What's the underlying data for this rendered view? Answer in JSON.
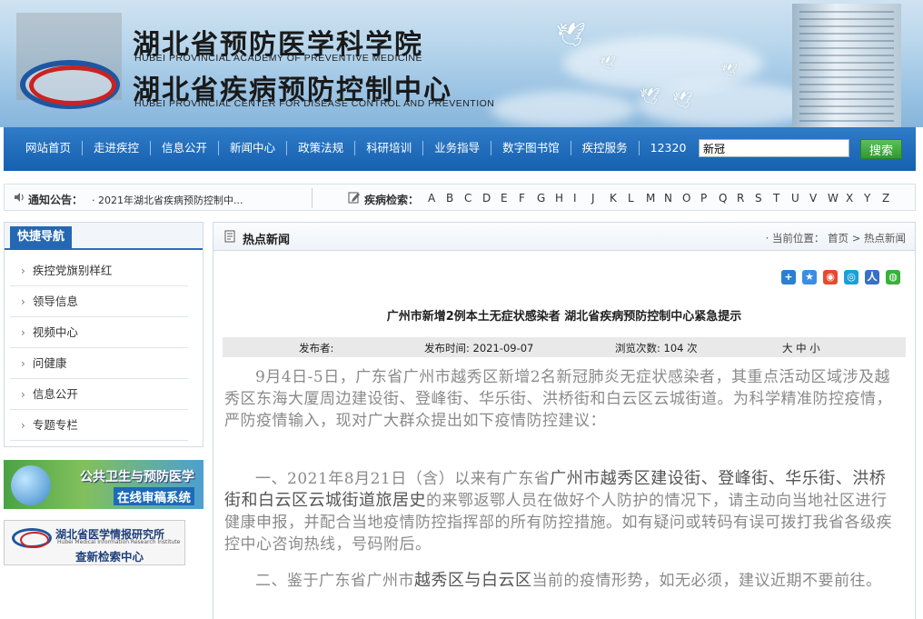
{
  "header": {
    "title_cn_1": "湖北省预防医学科学院",
    "title_en_1": "HUBEI PROVINCIAL ACADEMY OF PREVENTIVE MEDICINE",
    "title_cn_2": "湖北省疾病预防控制中心",
    "title_en_2": "HUBEI PROVINCIAL CENTER FOR DISEASE CONTROL AND PREVENTION"
  },
  "nav": {
    "items": [
      "网站首页",
      "走进疾控",
      "信息公开",
      "新闻中心",
      "政策法规",
      "科研培训",
      "业务指导",
      "数字图书馆",
      "疾控服务",
      "12320"
    ],
    "search_value": "新冠",
    "search_button": "搜索"
  },
  "notice": {
    "label": "通知公告：",
    "text": "· 2021年湖北省疾病预防控制中..."
  },
  "disease_index": {
    "label": "疾病检索：",
    "letters": [
      "A",
      "B",
      "C",
      "D",
      "E",
      "F",
      "G",
      "H",
      "I",
      "J",
      "K",
      "L",
      "M",
      "N",
      "O",
      "P",
      "Q",
      "R",
      "S",
      "T",
      "U",
      "V",
      "W",
      "X",
      "Y",
      "Z"
    ]
  },
  "sidebar": {
    "title": "快捷导航",
    "items": [
      "疾控党旗别样红",
      "领导信息",
      "视频中心",
      "问健康",
      "信息公开",
      "专题专栏"
    ]
  },
  "banners": {
    "b1_line1": "公共卫生与预防医学",
    "b1_line2": "在线审稿系统",
    "b2_line1": "湖北省医学情报研究所",
    "b2_line2": "Hubei Medical Information Research Institute",
    "b2_line3": "查新检索中心"
  },
  "main": {
    "section_title": "热点新闻",
    "breadcrumb": "· 当前位置： 首页 > 热点新闻",
    "article_title": "广州市新增2例本土无症状感染者 湖北省疾病预防控制中心紧急提示",
    "meta": {
      "publisher": "发布者:",
      "date": "发布时间: 2021-09-07",
      "views": "浏览次数: 104 次",
      "size": "大 中 小"
    },
    "paragraphs": {
      "p1": "9月4日-5日，广东省广州市越秀区新增2名新冠肺炎无症状感染者，其重点活动区域涉及越秀区东海大厦周边建设街、登峰街、华乐街、洪桥街和白云区云城街道。为科学精准防控疫情，严防疫情输入，现对广大群众提出如下疫情防控建议：",
      "p2_a": "一、2021年8月21日（含）以来有广东省",
      "p2_b": "广州市越秀区建设街、登峰街、华乐街、洪桥街和白云区云城街道旅居史",
      "p2_c": "的来鄂返鄂人员在做好个人防护的情况下，请主动向当地社区进行健康申报，并配合当地疫情防控指挥部的所有防控措施。如有疑问或转码有误可拨打我省各级疾控中心咨询热线，号码附后。",
      "p3_a": "二、鉴于广东省广州市",
      "p3_b": "越秀区与白云区",
      "p3_c": "当前的疫情形势，如无必须，建议近期不要前往。"
    }
  }
}
